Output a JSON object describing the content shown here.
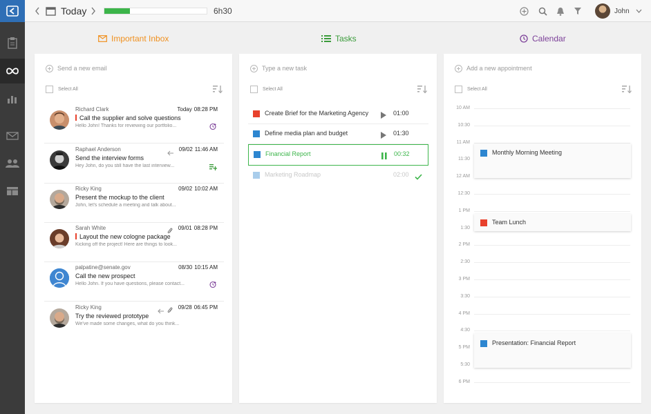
{
  "topbar": {
    "today_label": "Today",
    "progress_fraction": 0.25,
    "time_label": "6h30",
    "user_name": "John"
  },
  "sections": {
    "inbox_title": "Important Inbox",
    "tasks_title": "Tasks",
    "calendar_title": "Calendar"
  },
  "colors": {
    "inbox_accent": "#f0901e",
    "tasks_accent": "#3a9b3a",
    "calendar_accent": "#7b3f98",
    "red_task": "#e8412c",
    "blue_task": "#2d86d0",
    "light_blue_task": "#a9cdeb",
    "green_active": "#3cb54a"
  },
  "inbox": {
    "add_placeholder": "Send a new email",
    "select_all": "Select All",
    "emails": [
      {
        "sender": "Richard Clark",
        "day": "Today",
        "time": "08:28 PM",
        "subject": "Call the supplier and solve questions",
        "preview": "Hello John! Thanks for reviewing our portfolio...",
        "important": true,
        "action_icon": "clock-plus-icon"
      },
      {
        "sender": "Raphael Anderson",
        "day": "09/02",
        "time": "11:46 AM",
        "subject": "Send the interview forms",
        "preview": "Hey John, do you still have the last interview...",
        "important": false,
        "action_icon": "add-task-icon"
      },
      {
        "sender": "Ricky King",
        "day": "09/02",
        "time": "10:02 AM",
        "subject": "Present the mockup to the client",
        "preview": "John, let's schedule a meeting and talk about...",
        "important": false,
        "action_icon": ""
      },
      {
        "sender": "Sarah White",
        "day": "09/01",
        "time": "08:28 PM",
        "subject": "Layout the new cologne package",
        "preview": "Kicking off the project! Here are things to look...",
        "important": true,
        "action_icon": ""
      },
      {
        "sender": "palpatine@senate.gov",
        "day": "08/30",
        "time": "10:15 AM",
        "subject": "Call the new prospect",
        "preview": "Hello John.  If you have questions, please contact...",
        "important": false,
        "action_icon": "clock-plus-icon"
      },
      {
        "sender": "Ricky King",
        "day": "09/28",
        "time": "06:45 PM",
        "subject": "Try the reviewed prototype",
        "preview": "We've made some changes, what do you think...",
        "important": false,
        "action_icon": ""
      }
    ]
  },
  "tasks": {
    "add_placeholder": "Type a new task",
    "select_all": "Select All",
    "items": [
      {
        "name": "Create Brief for the Marketing Agency",
        "duration": "01:00",
        "color": "#e8412c",
        "state": "idle"
      },
      {
        "name": "Define media plan and budget",
        "duration": "01:30",
        "color": "#2d86d0",
        "state": "idle"
      },
      {
        "name": "Financial Report",
        "duration": "00:32",
        "color": "#2d86d0",
        "state": "running"
      },
      {
        "name": "Marketing Roadmap",
        "duration": "02:00",
        "color": "#a9cdeb",
        "state": "done"
      }
    ]
  },
  "calendar": {
    "add_placeholder": "Add a new appointment",
    "select_all": "Select All",
    "hours": [
      "10 AM",
      "10:30",
      "11 AM",
      "11:30",
      "12 AM",
      "12:30",
      "1 PM",
      "1:30",
      "2 PM",
      "2:30",
      "3 PM",
      "3:30",
      "4 PM",
      "4:30",
      "5 PM",
      "5:30",
      "6 PM"
    ],
    "appointments": [
      {
        "title": "Monthly Morning Meeting",
        "color": "#2d86d0"
      },
      {
        "title": "Team Lunch",
        "color": "#e8412c"
      },
      {
        "title": "Presentation: Financial Report",
        "color": "#2d86d0"
      }
    ]
  }
}
